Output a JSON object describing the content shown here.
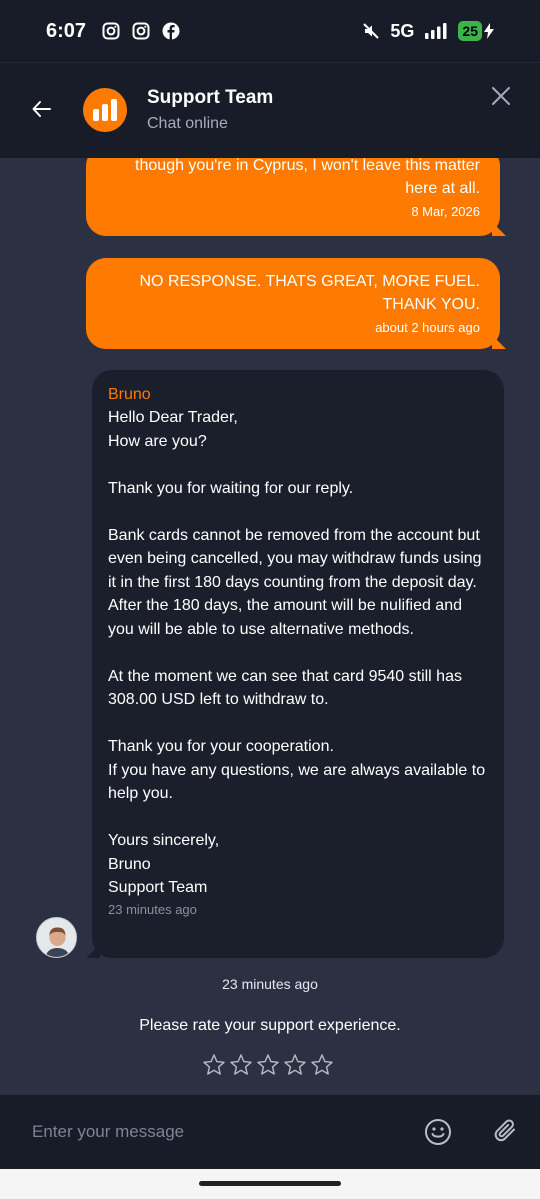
{
  "status_bar": {
    "time": "6:07",
    "network": "5G",
    "battery": "25",
    "icons": [
      "instagram-icon",
      "instagram-icon",
      "facebook-icon",
      "mute-icon",
      "signal-icon",
      "charging-icon"
    ]
  },
  "header": {
    "title": "Support Team",
    "subtitle": "Chat online"
  },
  "messages": {
    "out1": {
      "text": "though you're in Cyprus, I won't leave this matter\nhere at all.",
      "time": "8 Mar, 2026"
    },
    "out2": {
      "text": "NO RESPONSE. THATS GREAT, MORE FUEL.\nTHANK YOU.",
      "time": "about 2 hours ago"
    },
    "in1": {
      "sender": "Bruno",
      "text": "Hello Dear Trader,\nHow are you?\n\nThank you for waiting for our reply.\n\nBank cards cannot be removed from the account but even being cancelled, you may withdraw funds using it in the first 180 days counting from the deposit day. After the 180 days, the amount will be nulified and you will be able to use alternative methods.\n\nAt the moment we can see that card 9540 still has 308.00 USD left to withdraw to.\n\nThank you for your cooperation.\nIf you have any questions, we are always available to help you.\n\nYours sincerely,\nBruno\nSupport Team",
      "time": "23 minutes ago"
    }
  },
  "divider_time": "23 minutes ago",
  "rating": {
    "prompt": "Please rate your support experience.",
    "stars": 5,
    "selected": 0
  },
  "composer": {
    "placeholder": "Enter your message"
  },
  "colors": {
    "accent": "#ff7a00",
    "background": "#2b3142",
    "header": "#181c29",
    "incoming_bubble": "#1b1f2c"
  }
}
